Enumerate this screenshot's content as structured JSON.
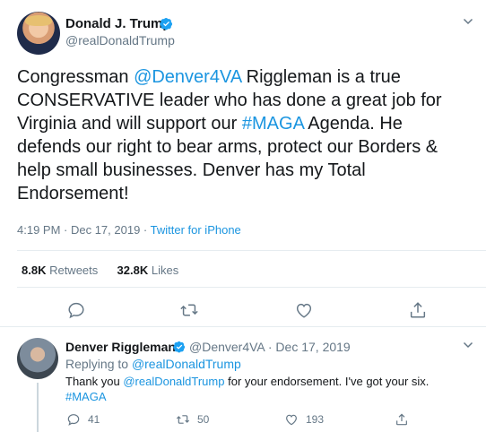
{
  "tweet": {
    "author_name": "Donald J. Trump",
    "author_handle": "@realDonaldTrump",
    "text_parts": {
      "p1": "Congressman ",
      "mention": "@Denver4VA",
      "p2": " Riggleman is a true CONSERVATIVE leader who has done a great job for Virginia and will support our ",
      "hashtag": "#MAGA",
      "p3": " Agenda. He defends our right to bear arms, protect our Borders & help small businesses. Denver has my Total Endorsement!"
    },
    "time": "4:19 PM · Dec 17, 2019 · ",
    "source": "Twitter for iPhone",
    "retweets_count": "8.8K",
    "retweets_label": " Retweets",
    "likes_count": "32.8K",
    "likes_label": " Likes"
  },
  "reply": {
    "author_name": "Denver Riggleman",
    "author_handle_date": "@Denver4VA · Dec 17, 2019",
    "replying_prefix": "Replying to ",
    "replying_to": "@realDonaldTrump",
    "text_p1": "Thank you ",
    "text_mention": "@realDonaldTrump",
    "text_p2": " for your endorsement.  I've got your six.",
    "text_hashtag": "#MAGA",
    "reply_count": "41",
    "retweet_count": "50",
    "like_count": "193"
  },
  "colors": {
    "link": "#1b95e0",
    "muted": "#657786",
    "text": "#14171a"
  }
}
